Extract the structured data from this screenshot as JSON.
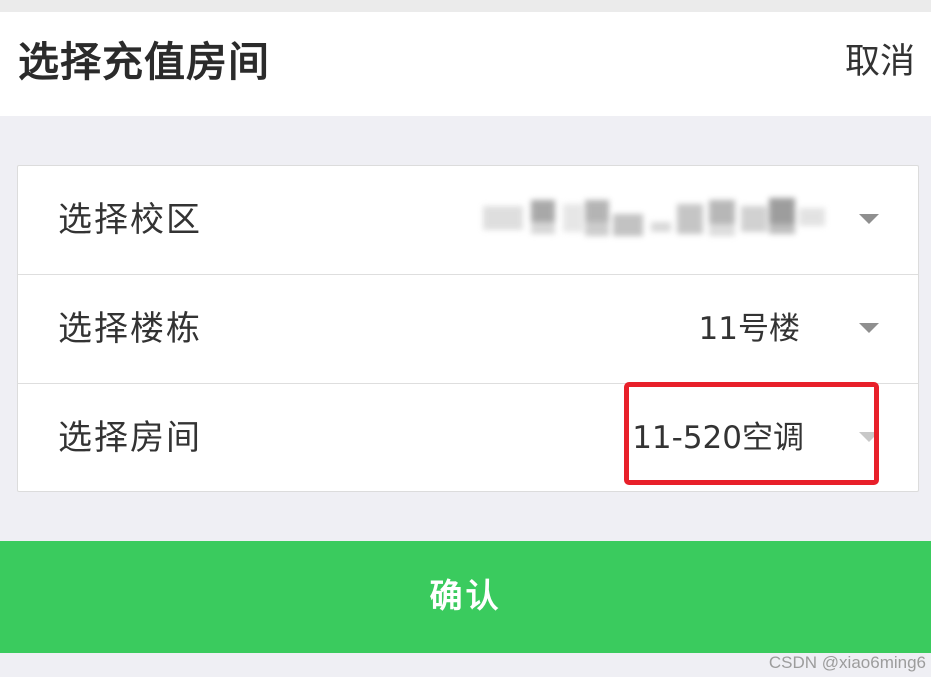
{
  "header": {
    "title": "选择充值房间",
    "cancel_label": "取消"
  },
  "form": {
    "rows": [
      {
        "label": "选择校区",
        "value": ""
      },
      {
        "label": "选择楼栋",
        "value": "11号楼"
      },
      {
        "label": "选择房间",
        "value": "11-520空调"
      }
    ]
  },
  "confirm_label": "确认",
  "watermark": "CSDN @xiao6ming6",
  "colors": {
    "confirm_background": "#3acb5e",
    "highlight_border": "#e8202a",
    "page_background": "#efeff4"
  }
}
